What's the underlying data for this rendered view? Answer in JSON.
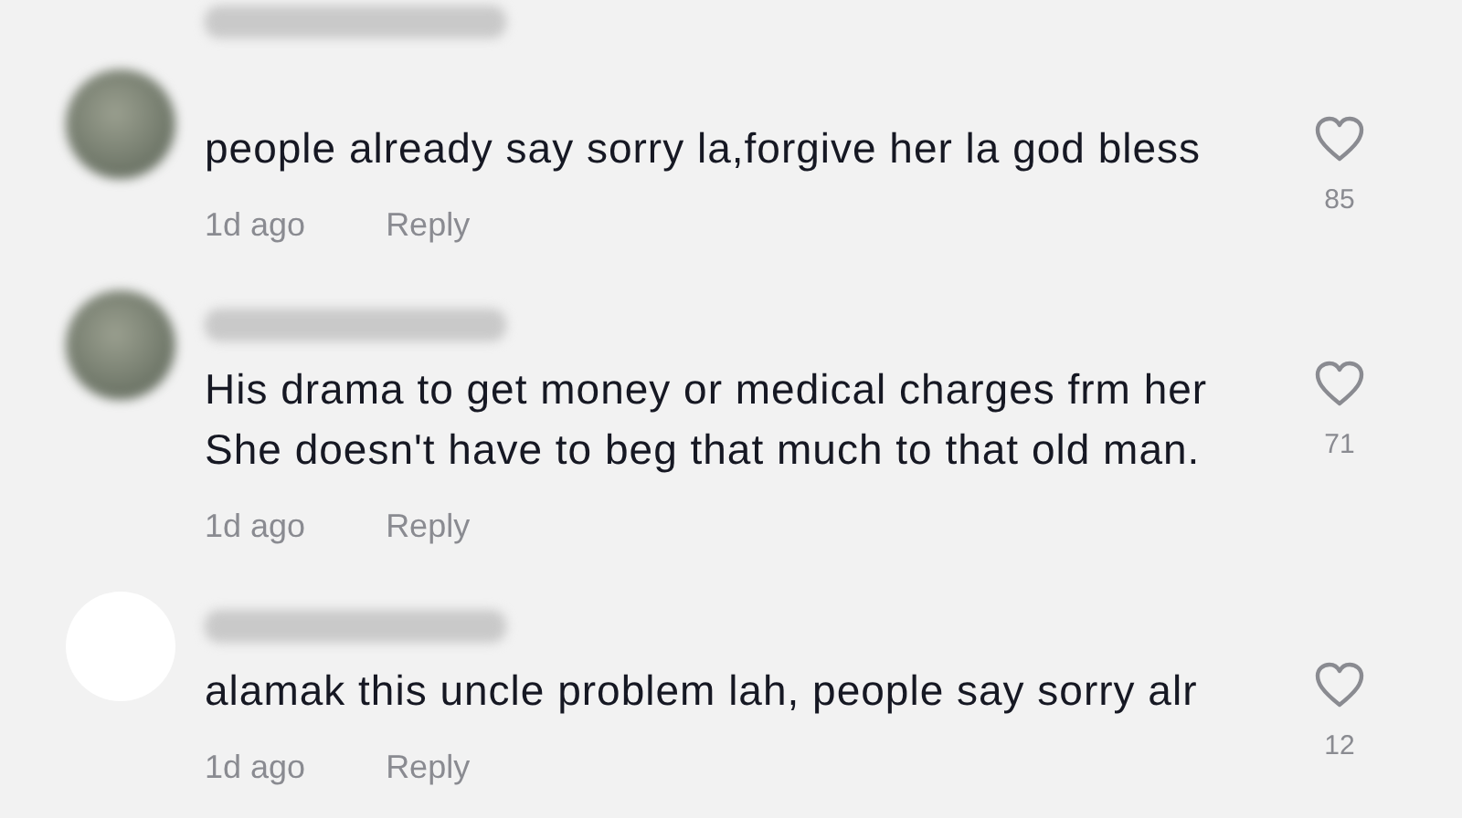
{
  "comments": [
    {
      "kind": "photo",
      "lines": [
        "people already say sorry la,forgive her la god bless"
      ],
      "time": "1d ago",
      "reply": "Reply",
      "likes": "85"
    },
    {
      "kind": "photo",
      "lines": [
        "His drama to get money or medical charges frm her",
        "She doesn't have to beg that much to that old man."
      ],
      "time": "1d ago",
      "reply": "Reply",
      "likes": "71"
    },
    {
      "kind": "blank",
      "lines": [
        "alamak this uncle problem lah, people say sorry alr"
      ],
      "time": "1d ago",
      "reply": "Reply",
      "likes": "12"
    }
  ]
}
